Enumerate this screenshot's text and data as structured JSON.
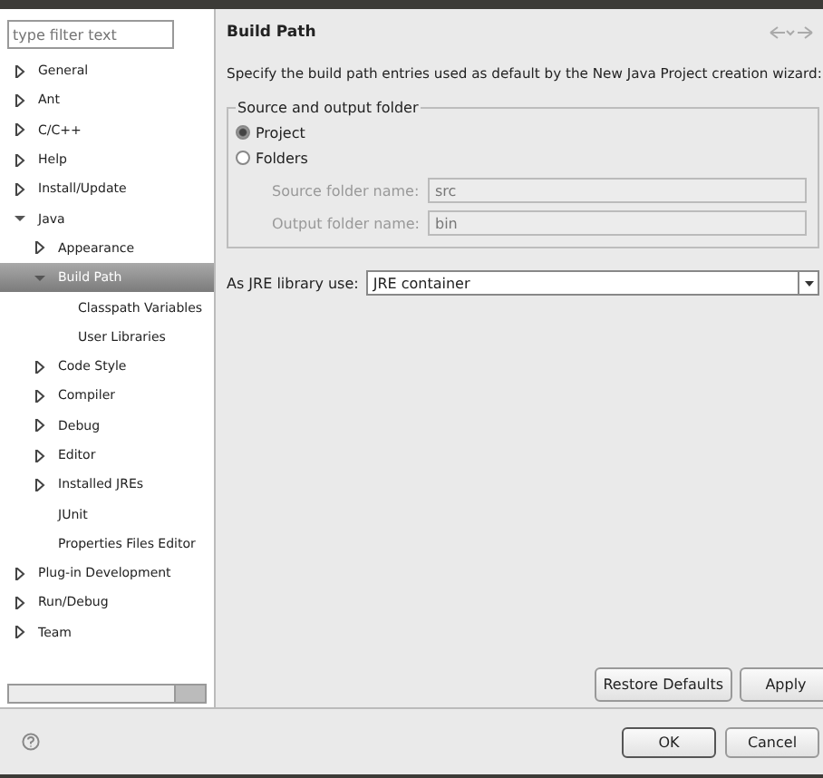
{
  "filter": {
    "placeholder": "type filter text"
  },
  "tree": [
    {
      "label": "General",
      "kind": "node",
      "expanded": false,
      "selected": false
    },
    {
      "label": "Ant",
      "kind": "node",
      "expanded": false,
      "selected": false
    },
    {
      "label": "C/C++",
      "kind": "node",
      "expanded": false,
      "selected": false
    },
    {
      "label": "Help",
      "kind": "node",
      "expanded": false,
      "selected": false
    },
    {
      "label": "Install/Update",
      "kind": "node",
      "expanded": false,
      "selected": false
    },
    {
      "label": "Java",
      "kind": "node",
      "expanded": true,
      "selected": false,
      "children": [
        {
          "label": "Appearance",
          "kind": "node",
          "expanded": false,
          "selected": false
        },
        {
          "label": "Build Path",
          "kind": "node",
          "expanded": true,
          "selected": true,
          "children": [
            {
              "label": "Classpath Variables",
              "kind": "leaf",
              "selected": false
            },
            {
              "label": "User Libraries",
              "kind": "leaf",
              "selected": false
            }
          ]
        },
        {
          "label": "Code Style",
          "kind": "node",
          "expanded": false,
          "selected": false
        },
        {
          "label": "Compiler",
          "kind": "node",
          "expanded": false,
          "selected": false
        },
        {
          "label": "Debug",
          "kind": "node",
          "expanded": false,
          "selected": false
        },
        {
          "label": "Editor",
          "kind": "node",
          "expanded": false,
          "selected": false
        },
        {
          "label": "Installed JREs",
          "kind": "node",
          "expanded": false,
          "selected": false
        },
        {
          "label": "JUnit",
          "kind": "leaf",
          "selected": false
        },
        {
          "label": "Properties Files Editor",
          "kind": "leaf",
          "selected": false
        }
      ]
    },
    {
      "label": "Plug-in Development",
      "kind": "node",
      "expanded": false,
      "selected": false
    },
    {
      "label": "Run/Debug",
      "kind": "node",
      "expanded": false,
      "selected": false
    },
    {
      "label": "Team",
      "kind": "node",
      "expanded": false,
      "selected": false
    }
  ],
  "page": {
    "title": "Build Path",
    "description": "Specify the build path entries used as default by the New Java Project creation wizard:",
    "group": {
      "title": "Source and output folder",
      "options": [
        {
          "label": "Project",
          "selected": true
        },
        {
          "label": "Folders",
          "selected": false
        }
      ],
      "fields": [
        {
          "label": "Source folder name:",
          "value": "src",
          "disabled": true
        },
        {
          "label": "Output folder name:",
          "value": "bin",
          "disabled": true
        }
      ]
    },
    "jre": {
      "label": "As JRE library use:",
      "value": "JRE container"
    },
    "buttons": [
      "Restore Defaults",
      "Apply"
    ]
  },
  "footer": {
    "buttons": [
      {
        "label": "OK",
        "default": true
      },
      {
        "label": "Cancel",
        "default": false
      }
    ]
  }
}
